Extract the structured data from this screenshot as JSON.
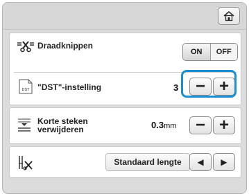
{
  "header": {
    "home_icon": "home-icon"
  },
  "settings": {
    "thread_cut": {
      "label": "Draadknippen",
      "on_label": "ON",
      "off_label": "OFF",
      "icon": "scissors-icon"
    },
    "dst": {
      "label": "\"DST\"-instelling",
      "value": "3",
      "icon_text": "DST",
      "minus": "−",
      "plus": "+"
    },
    "short_stitches": {
      "label_line1": "Korte steken",
      "label_line2": "verwijderen",
      "value": "0.3",
      "unit": "mm",
      "minus": "−",
      "plus": "+"
    },
    "length": {
      "value": "Standaard lengte",
      "left": "◀",
      "right": "▶",
      "icon": "needle-scissors-icon"
    }
  }
}
